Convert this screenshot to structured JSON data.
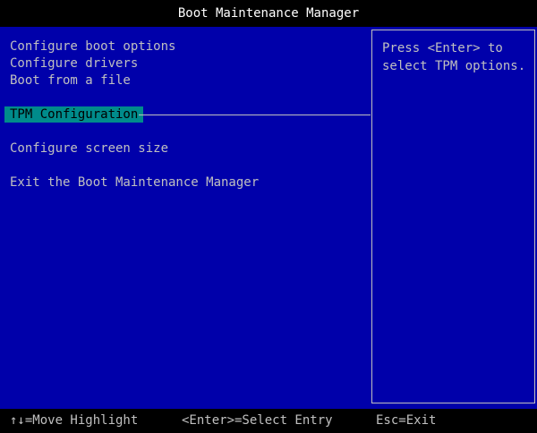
{
  "title": "Boot Maintenance Manager",
  "menu": {
    "items": [
      {
        "label": "Configure boot options"
      },
      {
        "label": "Configure drivers"
      },
      {
        "label": "Boot from a file"
      },
      {
        "label": "TPM Configuration",
        "selected": true
      },
      {
        "label": "Configure screen size"
      },
      {
        "label": "Exit the Boot Maintenance Manager"
      }
    ]
  },
  "help": {
    "text": "Press <Enter> to\nselect TPM options."
  },
  "footer": {
    "move": "↑↓=Move Highlight",
    "select": "<Enter>=Select Entry",
    "exit": "Esc=Exit"
  },
  "colors": {
    "background": "#0000aa",
    "bar": "#000000",
    "text": "#c0c0c0",
    "highlight": "#008b8b"
  }
}
